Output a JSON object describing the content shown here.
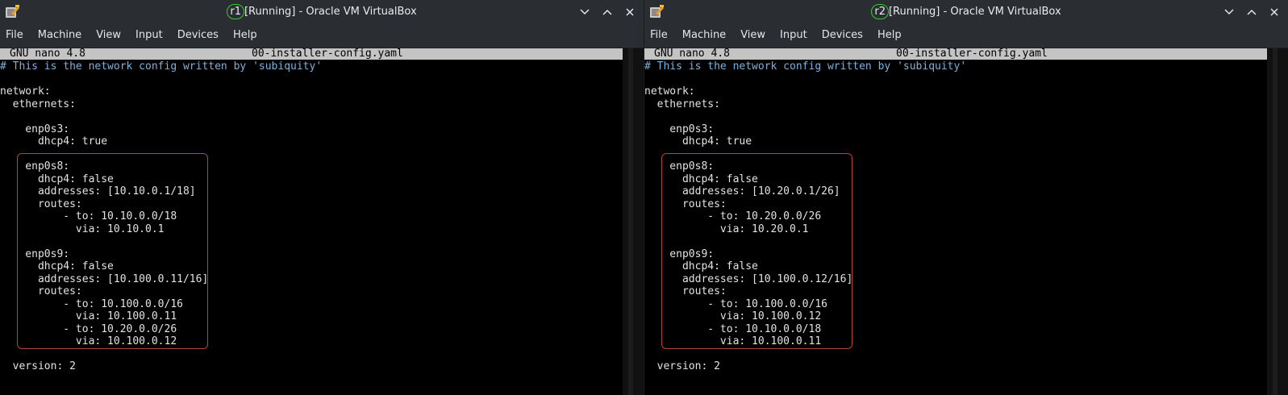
{
  "windows": [
    {
      "id": "left",
      "vm_name": "r1",
      "title_suffix": "[Running] - Oracle VM VirtualBox",
      "menu": [
        "File",
        "Machine",
        "View",
        "Input",
        "Devices",
        "Help"
      ],
      "nano": {
        "version": "GNU nano 4.8",
        "filename": "00-installer-config.yaml"
      },
      "lines": [
        "# This is the network config written by 'subiquity'",
        "",
        "network:",
        "  ethernets:",
        "",
        "    enp0s3:",
        "      dhcp4: true",
        "",
        "    enp0s8:",
        "      dhcp4: false",
        "      addresses: [10.10.0.1/18]",
        "      routes:",
        "          - to: 10.10.0.0/18",
        "            via: 10.10.0.1",
        "",
        "    enp0s9:",
        "      dhcp4: false",
        "      addresses: [10.100.0.11/16]",
        "      routes:",
        "          - to: 10.100.0.0/16",
        "            via: 10.100.0.11",
        "          - to: 10.20.0.0/26",
        "            via: 10.100.0.12",
        "",
        "  version: 2"
      ]
    },
    {
      "id": "right",
      "vm_name": "r2",
      "title_suffix": "[Running] - Oracle VM VirtualBox",
      "menu": [
        "File",
        "Machine",
        "View",
        "Input",
        "Devices",
        "Help"
      ],
      "nano": {
        "version": "GNU nano 4.8",
        "filename": "00-installer-config.yaml"
      },
      "lines": [
        "# This is the network config written by 'subiquity'",
        "",
        "network:",
        "  ethernets:",
        "",
        "    enp0s3:",
        "      dhcp4: true",
        "",
        "    enp0s8:",
        "      dhcp4: false",
        "      addresses: [10.20.0.1/26]",
        "      routes:",
        "          - to: 10.20.0.0/26",
        "            via: 10.20.0.1",
        "",
        "    enp0s9:",
        "      dhcp4: false",
        "      addresses: [10.100.0.12/16]",
        "      routes:",
        "          - to: 10.100.0.0/16",
        "            via: 10.100.0.12",
        "          - to: 10.10.0.0/18",
        "            via: 10.100.0.11",
        "",
        "  version: 2"
      ]
    }
  ],
  "colors": {
    "titlebar": "#2a2e32",
    "terminal_bg": "#000000",
    "terminal_text": "#e2e2e2",
    "comment": "#7eb0dc",
    "nano_header_bg": "#c4c4c4",
    "highlight_border": "#b8433a",
    "vm_badge_border": "#3fc43f"
  },
  "icons": [
    "virtualbox-app-icon",
    "chevron-down-icon",
    "chevron-up-icon",
    "close-icon"
  ]
}
